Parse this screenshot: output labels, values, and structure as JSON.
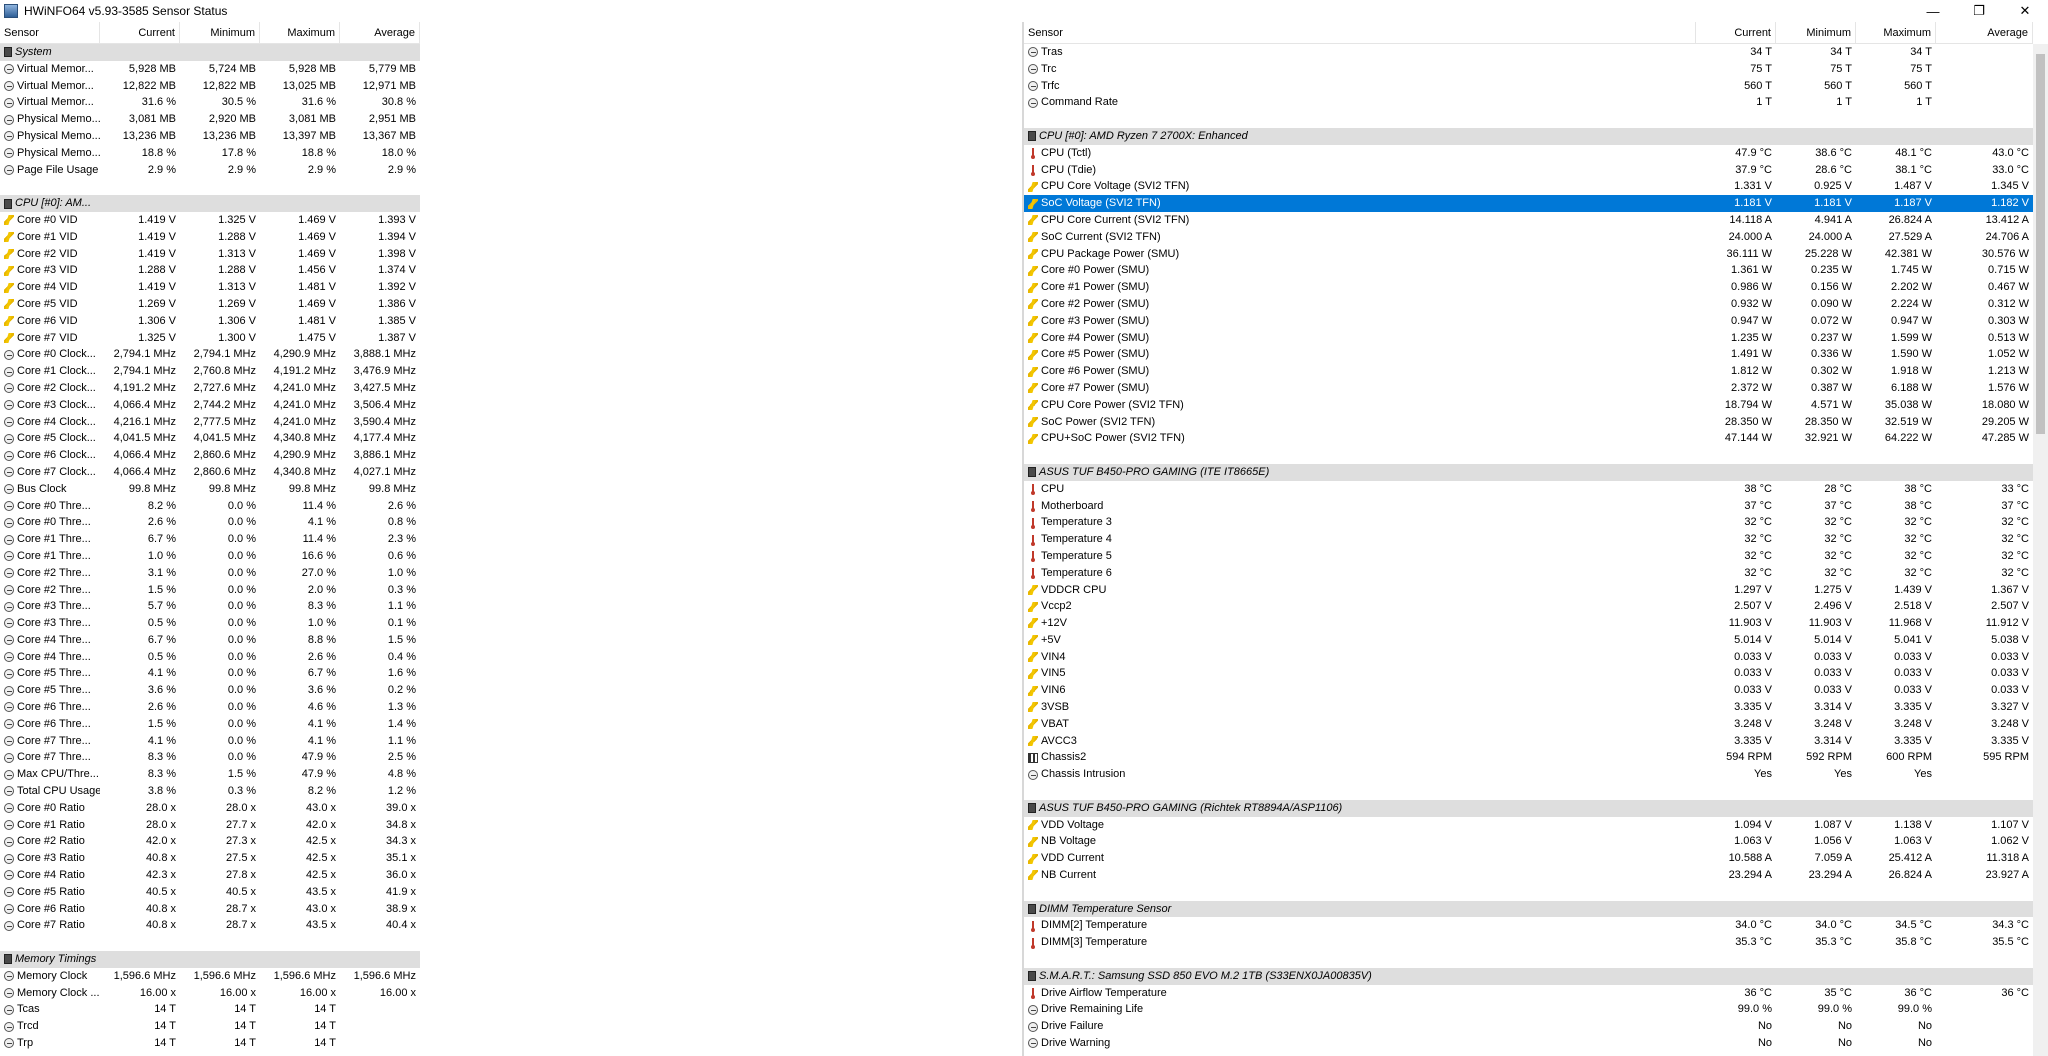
{
  "window": {
    "title": "HWiNFO64 v5.93-3585 Sensor Status"
  },
  "left": {
    "headers": [
      "Sensor",
      "Current",
      "Minimum",
      "Maximum",
      "Average"
    ],
    "rows": [
      [
        "g",
        "",
        "System",
        "",
        "",
        "",
        ""
      ],
      [
        "r",
        "clock",
        "Virtual Memor...",
        "5,928 MB",
        "5,724 MB",
        "5,928 MB",
        "5,779 MB"
      ],
      [
        "r",
        "clock",
        "Virtual Memor...",
        "12,822 MB",
        "12,822 MB",
        "13,025 MB",
        "12,971 MB"
      ],
      [
        "r",
        "clock",
        "Virtual Memor...",
        "31.6 %",
        "30.5 %",
        "31.6 %",
        "30.8 %"
      ],
      [
        "r",
        "clock",
        "Physical Memo...",
        "3,081 MB",
        "2,920 MB",
        "3,081 MB",
        "2,951 MB"
      ],
      [
        "r",
        "clock",
        "Physical Memo...",
        "13,236 MB",
        "13,236 MB",
        "13,397 MB",
        "13,367 MB"
      ],
      [
        "r",
        "clock",
        "Physical Memo...",
        "18.8 %",
        "17.8 %",
        "18.8 %",
        "18.0 %"
      ],
      [
        "r",
        "clock",
        "Page File Usage",
        "2.9 %",
        "2.9 %",
        "2.9 %",
        "2.9 %"
      ],
      [
        "s",
        "",
        "",
        "",
        "",
        "",
        ""
      ],
      [
        "g",
        "",
        "CPU [#0]: AM...",
        "",
        "",
        "",
        ""
      ],
      [
        "r",
        "volt",
        "Core #0 VID",
        "1.419 V",
        "1.325 V",
        "1.469 V",
        "1.393 V"
      ],
      [
        "r",
        "volt",
        "Core #1 VID",
        "1.419 V",
        "1.288 V",
        "1.469 V",
        "1.394 V"
      ],
      [
        "r",
        "volt",
        "Core #2 VID",
        "1.419 V",
        "1.313 V",
        "1.469 V",
        "1.398 V"
      ],
      [
        "r",
        "volt",
        "Core #3 VID",
        "1.288 V",
        "1.288 V",
        "1.456 V",
        "1.374 V"
      ],
      [
        "r",
        "volt",
        "Core #4 VID",
        "1.419 V",
        "1.313 V",
        "1.481 V",
        "1.392 V"
      ],
      [
        "r",
        "volt",
        "Core #5 VID",
        "1.269 V",
        "1.269 V",
        "1.469 V",
        "1.386 V"
      ],
      [
        "r",
        "volt",
        "Core #6 VID",
        "1.306 V",
        "1.306 V",
        "1.481 V",
        "1.385 V"
      ],
      [
        "r",
        "volt",
        "Core #7 VID",
        "1.325 V",
        "1.300 V",
        "1.475 V",
        "1.387 V"
      ],
      [
        "r",
        "clock",
        "Core #0 Clock...",
        "2,794.1 MHz",
        "2,794.1 MHz",
        "4,290.9 MHz",
        "3,888.1 MHz"
      ],
      [
        "r",
        "clock",
        "Core #1 Clock...",
        "2,794.1 MHz",
        "2,760.8 MHz",
        "4,191.2 MHz",
        "3,476.9 MHz"
      ],
      [
        "r",
        "clock",
        "Core #2 Clock...",
        "4,191.2 MHz",
        "2,727.6 MHz",
        "4,241.0 MHz",
        "3,427.5 MHz"
      ],
      [
        "r",
        "clock",
        "Core #3 Clock...",
        "4,066.4 MHz",
        "2,744.2 MHz",
        "4,241.0 MHz",
        "3,506.4 MHz"
      ],
      [
        "r",
        "clock",
        "Core #4 Clock...",
        "4,216.1 MHz",
        "2,777.5 MHz",
        "4,241.0 MHz",
        "3,590.4 MHz"
      ],
      [
        "r",
        "clock",
        "Core #5 Clock...",
        "4,041.5 MHz",
        "4,041.5 MHz",
        "4,340.8 MHz",
        "4,177.4 MHz"
      ],
      [
        "r",
        "clock",
        "Core #6 Clock...",
        "4,066.4 MHz",
        "2,860.6 MHz",
        "4,290.9 MHz",
        "3,886.1 MHz"
      ],
      [
        "r",
        "clock",
        "Core #7 Clock...",
        "4,066.4 MHz",
        "2,860.6 MHz",
        "4,340.8 MHz",
        "4,027.1 MHz"
      ],
      [
        "r",
        "clock",
        "Bus Clock",
        "99.8 MHz",
        "99.8 MHz",
        "99.8 MHz",
        "99.8 MHz"
      ],
      [
        "r",
        "clock",
        "Core #0 Thre...",
        "8.2 %",
        "0.0 %",
        "11.4 %",
        "2.6 %"
      ],
      [
        "r",
        "clock",
        "Core #0 Thre...",
        "2.6 %",
        "0.0 %",
        "4.1 %",
        "0.8 %"
      ],
      [
        "r",
        "clock",
        "Core #1 Thre...",
        "6.7 %",
        "0.0 %",
        "11.4 %",
        "2.3 %"
      ],
      [
        "r",
        "clock",
        "Core #1 Thre...",
        "1.0 %",
        "0.0 %",
        "16.6 %",
        "0.6 %"
      ],
      [
        "r",
        "clock",
        "Core #2 Thre...",
        "3.1 %",
        "0.0 %",
        "27.0 %",
        "1.0 %"
      ],
      [
        "r",
        "clock",
        "Core #2 Thre...",
        "1.5 %",
        "0.0 %",
        "2.0 %",
        "0.3 %"
      ],
      [
        "r",
        "clock",
        "Core #3 Thre...",
        "5.7 %",
        "0.0 %",
        "8.3 %",
        "1.1 %"
      ],
      [
        "r",
        "clock",
        "Core #3 Thre...",
        "0.5 %",
        "0.0 %",
        "1.0 %",
        "0.1 %"
      ],
      [
        "r",
        "clock",
        "Core #4 Thre...",
        "6.7 %",
        "0.0 %",
        "8.8 %",
        "1.5 %"
      ],
      [
        "r",
        "clock",
        "Core #4 Thre...",
        "0.5 %",
        "0.0 %",
        "2.6 %",
        "0.4 %"
      ],
      [
        "r",
        "clock",
        "Core #5 Thre...",
        "4.1 %",
        "0.0 %",
        "6.7 %",
        "1.6 %"
      ],
      [
        "r",
        "clock",
        "Core #5 Thre...",
        "3.6 %",
        "0.0 %",
        "3.6 %",
        "0.2 %"
      ],
      [
        "r",
        "clock",
        "Core #6 Thre...",
        "2.6 %",
        "0.0 %",
        "4.6 %",
        "1.3 %"
      ],
      [
        "r",
        "clock",
        "Core #6 Thre...",
        "1.5 %",
        "0.0 %",
        "4.1 %",
        "1.4 %"
      ],
      [
        "r",
        "clock",
        "Core #7 Thre...",
        "4.1 %",
        "0.0 %",
        "4.1 %",
        "1.1 %"
      ],
      [
        "r",
        "clock",
        "Core #7 Thre...",
        "8.3 %",
        "0.0 %",
        "47.9 %",
        "2.5 %"
      ],
      [
        "r",
        "clock",
        "Max CPU/Thre...",
        "8.3 %",
        "1.5 %",
        "47.9 %",
        "4.8 %"
      ],
      [
        "r",
        "clock",
        "Total CPU Usage",
        "3.8 %",
        "0.3 %",
        "8.2 %",
        "1.2 %"
      ],
      [
        "r",
        "clock",
        "Core #0 Ratio",
        "28.0 x",
        "28.0 x",
        "43.0 x",
        "39.0 x"
      ],
      [
        "r",
        "clock",
        "Core #1 Ratio",
        "28.0 x",
        "27.7 x",
        "42.0 x",
        "34.8 x"
      ],
      [
        "r",
        "clock",
        "Core #2 Ratio",
        "42.0 x",
        "27.3 x",
        "42.5 x",
        "34.3 x"
      ],
      [
        "r",
        "clock",
        "Core #3 Ratio",
        "40.8 x",
        "27.5 x",
        "42.5 x",
        "35.1 x"
      ],
      [
        "r",
        "clock",
        "Core #4 Ratio",
        "42.3 x",
        "27.8 x",
        "42.5 x",
        "36.0 x"
      ],
      [
        "r",
        "clock",
        "Core #5 Ratio",
        "40.5 x",
        "40.5 x",
        "43.5 x",
        "41.9 x"
      ],
      [
        "r",
        "clock",
        "Core #6 Ratio",
        "40.8 x",
        "28.7 x",
        "43.0 x",
        "38.9 x"
      ],
      [
        "r",
        "clock",
        "Core #7 Ratio",
        "40.8 x",
        "28.7 x",
        "43.5 x",
        "40.4 x"
      ],
      [
        "s",
        "",
        "",
        "",
        "",
        "",
        ""
      ],
      [
        "g",
        "",
        "Memory Timings",
        "",
        "",
        "",
        ""
      ],
      [
        "r",
        "clock",
        "Memory Clock",
        "1,596.6 MHz",
        "1,596.6 MHz",
        "1,596.6 MHz",
        "1,596.6 MHz"
      ],
      [
        "r",
        "clock",
        "Memory Clock ...",
        "16.00 x",
        "16.00 x",
        "16.00 x",
        "16.00 x"
      ],
      [
        "r",
        "clock",
        "Tcas",
        "14 T",
        "14 T",
        "14 T",
        ""
      ],
      [
        "r",
        "clock",
        "Trcd",
        "14 T",
        "14 T",
        "14 T",
        ""
      ],
      [
        "r",
        "clock",
        "Trp",
        "14 T",
        "14 T",
        "14 T",
        ""
      ]
    ]
  },
  "right": {
    "headers": [
      "Sensor",
      "Current",
      "Minimum",
      "Maximum",
      "Average"
    ],
    "rows": [
      [
        "r",
        "clock",
        "Tras",
        "34 T",
        "34 T",
        "34 T",
        ""
      ],
      [
        "r",
        "clock",
        "Trc",
        "75 T",
        "75 T",
        "75 T",
        ""
      ],
      [
        "r",
        "clock",
        "Trfc",
        "560 T",
        "560 T",
        "560 T",
        ""
      ],
      [
        "r",
        "clock",
        "Command Rate",
        "1 T",
        "1 T",
        "1 T",
        ""
      ],
      [
        "s",
        "",
        "",
        "",
        "",
        "",
        ""
      ],
      [
        "g",
        "",
        "CPU [#0]: AMD Ryzen 7 2700X: Enhanced",
        "",
        "",
        "",
        ""
      ],
      [
        "r",
        "temp",
        "CPU (Tctl)",
        "47.9 °C",
        "38.6 °C",
        "48.1 °C",
        "43.0 °C"
      ],
      [
        "r",
        "temp",
        "CPU (Tdie)",
        "37.9 °C",
        "28.6 °C",
        "38.1 °C",
        "33.0 °C"
      ],
      [
        "r",
        "volt",
        "CPU Core Voltage (SVI2 TFN)",
        "1.331 V",
        "0.925 V",
        "1.487 V",
        "1.345 V"
      ],
      [
        "sel",
        "volt",
        "SoC Voltage (SVI2 TFN)",
        "1.181 V",
        "1.181 V",
        "1.187 V",
        "1.182 V"
      ],
      [
        "r",
        "volt",
        "CPU Core Current (SVI2 TFN)",
        "14.118 A",
        "4.941 A",
        "26.824 A",
        "13.412 A"
      ],
      [
        "r",
        "volt",
        "SoC Current (SVI2 TFN)",
        "24.000 A",
        "24.000 A",
        "27.529 A",
        "24.706 A"
      ],
      [
        "r",
        "volt",
        "CPU Package Power (SMU)",
        "36.111 W",
        "25.228 W",
        "42.381 W",
        "30.576 W"
      ],
      [
        "r",
        "volt",
        "Core #0 Power (SMU)",
        "1.361 W",
        "0.235 W",
        "1.745 W",
        "0.715 W"
      ],
      [
        "r",
        "volt",
        "Core #1 Power (SMU)",
        "0.986 W",
        "0.156 W",
        "2.202 W",
        "0.467 W"
      ],
      [
        "r",
        "volt",
        "Core #2 Power (SMU)",
        "0.932 W",
        "0.090 W",
        "2.224 W",
        "0.312 W"
      ],
      [
        "r",
        "volt",
        "Core #3 Power (SMU)",
        "0.947 W",
        "0.072 W",
        "0.947 W",
        "0.303 W"
      ],
      [
        "r",
        "volt",
        "Core #4 Power (SMU)",
        "1.235 W",
        "0.237 W",
        "1.599 W",
        "0.513 W"
      ],
      [
        "r",
        "volt",
        "Core #5 Power (SMU)",
        "1.491 W",
        "0.336 W",
        "1.590 W",
        "1.052 W"
      ],
      [
        "r",
        "volt",
        "Core #6 Power (SMU)",
        "1.812 W",
        "0.302 W",
        "1.918 W",
        "1.213 W"
      ],
      [
        "r",
        "volt",
        "Core #7 Power (SMU)",
        "2.372 W",
        "0.387 W",
        "6.188 W",
        "1.576 W"
      ],
      [
        "r",
        "volt",
        "CPU Core Power (SVI2 TFN)",
        "18.794 W",
        "4.571 W",
        "35.038 W",
        "18.080 W"
      ],
      [
        "r",
        "volt",
        "SoC Power (SVI2 TFN)",
        "28.350 W",
        "28.350 W",
        "32.519 W",
        "29.205 W"
      ],
      [
        "r",
        "volt",
        "CPU+SoC Power (SVI2 TFN)",
        "47.144 W",
        "32.921 W",
        "64.222 W",
        "47.285 W"
      ],
      [
        "s",
        "",
        "",
        "",
        "",
        "",
        ""
      ],
      [
        "g",
        "",
        "ASUS TUF B450-PRO GAMING (ITE IT8665E)",
        "",
        "",
        "",
        ""
      ],
      [
        "r",
        "temp",
        "CPU",
        "38 °C",
        "28 °C",
        "38 °C",
        "33 °C"
      ],
      [
        "r",
        "temp",
        "Motherboard",
        "37 °C",
        "37 °C",
        "38 °C",
        "37 °C"
      ],
      [
        "r",
        "temp",
        "Temperature 3",
        "32 °C",
        "32 °C",
        "32 °C",
        "32 °C"
      ],
      [
        "r",
        "temp",
        "Temperature 4",
        "32 °C",
        "32 °C",
        "32 °C",
        "32 °C"
      ],
      [
        "r",
        "temp",
        "Temperature 5",
        "32 °C",
        "32 °C",
        "32 °C",
        "32 °C"
      ],
      [
        "r",
        "temp",
        "Temperature 6",
        "32 °C",
        "32 °C",
        "32 °C",
        "32 °C"
      ],
      [
        "r",
        "volt",
        "VDDCR CPU",
        "1.297 V",
        "1.275 V",
        "1.439 V",
        "1.367 V"
      ],
      [
        "r",
        "volt",
        "Vccp2",
        "2.507 V",
        "2.496 V",
        "2.518 V",
        "2.507 V"
      ],
      [
        "r",
        "volt",
        "+12V",
        "11.903 V",
        "11.903 V",
        "11.968 V",
        "11.912 V"
      ],
      [
        "r",
        "volt",
        "+5V",
        "5.014 V",
        "5.014 V",
        "5.041 V",
        "5.038 V"
      ],
      [
        "r",
        "volt",
        "VIN4",
        "0.033 V",
        "0.033 V",
        "0.033 V",
        "0.033 V"
      ],
      [
        "r",
        "volt",
        "VIN5",
        "0.033 V",
        "0.033 V",
        "0.033 V",
        "0.033 V"
      ],
      [
        "r",
        "volt",
        "VIN6",
        "0.033 V",
        "0.033 V",
        "0.033 V",
        "0.033 V"
      ],
      [
        "r",
        "volt",
        "3VSB",
        "3.335 V",
        "3.314 V",
        "3.335 V",
        "3.327 V"
      ],
      [
        "r",
        "volt",
        "VBAT",
        "3.248 V",
        "3.248 V",
        "3.248 V",
        "3.248 V"
      ],
      [
        "r",
        "volt",
        "AVCC3",
        "3.335 V",
        "3.314 V",
        "3.335 V",
        "3.335 V"
      ],
      [
        "r",
        "fan",
        "Chassis2",
        "594 RPM",
        "592 RPM",
        "600 RPM",
        "595 RPM"
      ],
      [
        "r",
        "clock",
        "Chassis Intrusion",
        "Yes",
        "Yes",
        "Yes",
        ""
      ],
      [
        "s",
        "",
        "",
        "",
        "",
        "",
        ""
      ],
      [
        "g",
        "",
        "ASUS TUF B450-PRO GAMING (Richtek RT8894A/ASP1106)",
        "",
        "",
        "",
        ""
      ],
      [
        "r",
        "volt",
        "VDD Voltage",
        "1.094 V",
        "1.087 V",
        "1.138 V",
        "1.107 V"
      ],
      [
        "r",
        "volt",
        "NB Voltage",
        "1.063 V",
        "1.056 V",
        "1.063 V",
        "1.062 V"
      ],
      [
        "r",
        "volt",
        "VDD Current",
        "10.588 A",
        "7.059 A",
        "25.412 A",
        "11.318 A"
      ],
      [
        "r",
        "volt",
        "NB Current",
        "23.294 A",
        "23.294 A",
        "26.824 A",
        "23.927 A"
      ],
      [
        "s",
        "",
        "",
        "",
        "",
        "",
        ""
      ],
      [
        "g",
        "",
        "DIMM Temperature Sensor",
        "",
        "",
        "",
        ""
      ],
      [
        "r",
        "temp",
        "DIMM[2] Temperature",
        "34.0 °C",
        "34.0 °C",
        "34.5 °C",
        "34.3 °C"
      ],
      [
        "r",
        "temp",
        "DIMM[3] Temperature",
        "35.3 °C",
        "35.3 °C",
        "35.8 °C",
        "35.5 °C"
      ],
      [
        "s",
        "",
        "",
        "",
        "",
        "",
        ""
      ],
      [
        "g",
        "",
        "S.M.A.R.T.: Samsung SSD 850 EVO M.2 1TB (S33ENX0JA00835V)",
        "",
        "",
        "",
        ""
      ],
      [
        "r",
        "temp",
        "Drive Airflow Temperature",
        "36 °C",
        "35 °C",
        "36 °C",
        "36 °C"
      ],
      [
        "r",
        "clock",
        "Drive Remaining Life",
        "99.0 %",
        "99.0 %",
        "99.0 %",
        ""
      ],
      [
        "r",
        "clock",
        "Drive Failure",
        "No",
        "No",
        "No",
        ""
      ],
      [
        "r",
        "clock",
        "Drive Warning",
        "No",
        "No",
        "No",
        ""
      ]
    ]
  }
}
